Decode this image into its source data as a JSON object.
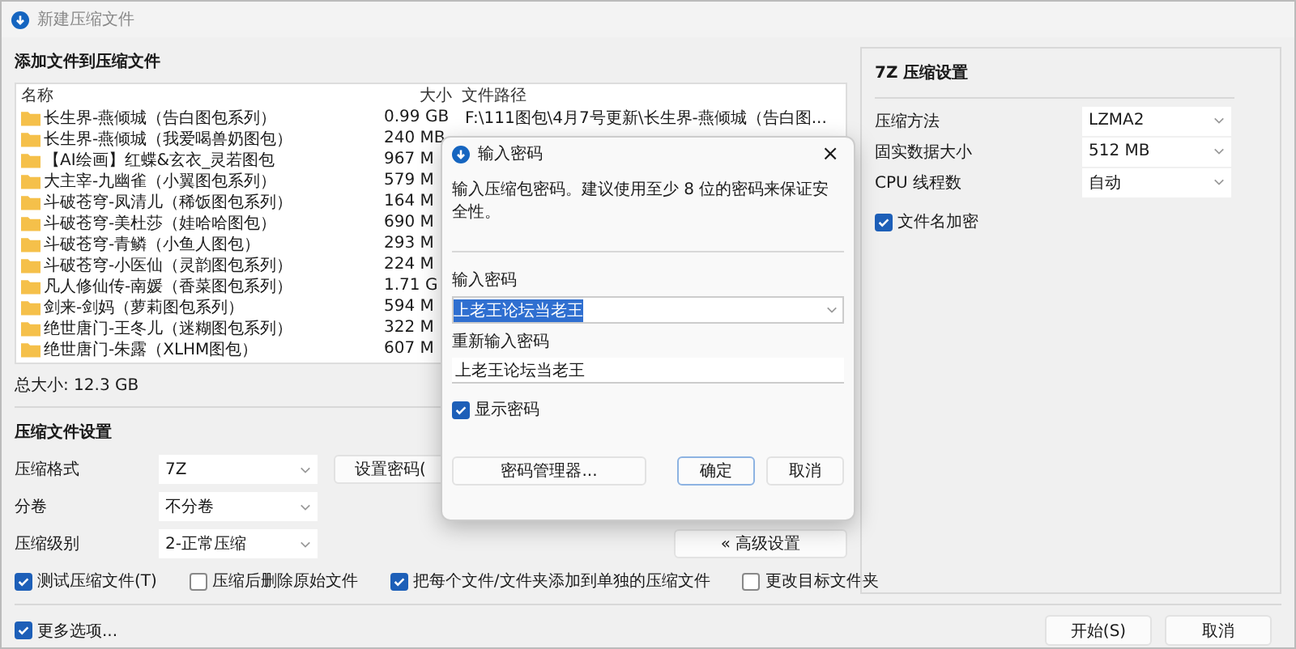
{
  "window": {
    "title": "新建压缩文件"
  },
  "files": {
    "heading": "添加文件到压缩文件",
    "columns": [
      "名称",
      "大小",
      "文件路径"
    ],
    "rows": [
      {
        "name": "长生界-燕倾城（告白图包系列）",
        "size": "0.99 GB",
        "path": "F:\\111图包\\4月7号更新\\长生界-燕倾城（告白图..."
      },
      {
        "name": "长生界-燕倾城（我爱喝兽奶图包）",
        "size": "240 MB"
      },
      {
        "name": "【AI绘画】红蝶&玄衣_灵若图包",
        "size": "967 M"
      },
      {
        "name": "大主宰-九幽雀（小翼图包系列）",
        "size": "579 M"
      },
      {
        "name": "斗破苍穹-凤清儿（稀饭图包系列）",
        "size": "164 M"
      },
      {
        "name": "斗破苍穹-美杜莎（娃哈哈图包）",
        "size": "690 M"
      },
      {
        "name": "斗破苍穹-青鳞（小鱼人图包）",
        "size": "293 M"
      },
      {
        "name": "斗破苍穹-小医仙（灵韵图包系列）",
        "size": "224 M"
      },
      {
        "name": "凡人修仙传-南媛（香菜图包系列）",
        "size": "1.71 G"
      },
      {
        "name": "剑来-剑妈（萝莉图包系列）",
        "size": "594 M"
      },
      {
        "name": "绝世唐门-王冬儿（迷糊图包系列）",
        "size": "322 M"
      },
      {
        "name": "绝世唐门-朱露（XLHM图包）",
        "size": "607 M"
      }
    ],
    "total": "总大小: 12.3 GB"
  },
  "settings": {
    "heading": "压缩文件设置",
    "fields": [
      {
        "label": "压缩格式",
        "value": "7Z"
      },
      {
        "label": "分卷",
        "value": "不分卷"
      },
      {
        "label": "压缩级别",
        "value": "2-正常压缩"
      }
    ],
    "password_button": "设置密码(",
    "advanced_button": "« 高级设置",
    "options": [
      {
        "label": "测试压缩文件(T)",
        "checked": true
      },
      {
        "label": "压缩后删除原始文件",
        "checked": false
      },
      {
        "label": "把每个文件/文件夹添加到单独的压缩文件",
        "checked": true
      },
      {
        "label": "更改目标文件夹",
        "checked": false
      }
    ]
  },
  "seven_zip": {
    "heading": "7Z 压缩设置",
    "fields": [
      {
        "label": "压缩方法",
        "value": "LZMA2"
      },
      {
        "label": "固实数据大小",
        "value": "512 MB"
      },
      {
        "label": "CPU 线程数",
        "value": "自动"
      }
    ],
    "encrypt_names": {
      "label": "文件名加密",
      "checked": true
    }
  },
  "footer": {
    "more": {
      "label": "更多选项...",
      "checked": true
    },
    "buttons": [
      "开始(S)",
      "取消"
    ]
  },
  "dialog": {
    "title": "输入密码",
    "close": "×",
    "message": "输入压缩包密码。建议使用至少 8 位的密码来保证安全性。",
    "password_label": "输入密码",
    "password": "上老王论坛当老王",
    "confirm_label": "重新输入密码",
    "confirm": "上老王论坛当老王",
    "show_password": {
      "label": "显示密码",
      "checked": true
    },
    "manager_button": "密码管理器...",
    "ok_button": "确定",
    "cancel_button": "取消"
  }
}
